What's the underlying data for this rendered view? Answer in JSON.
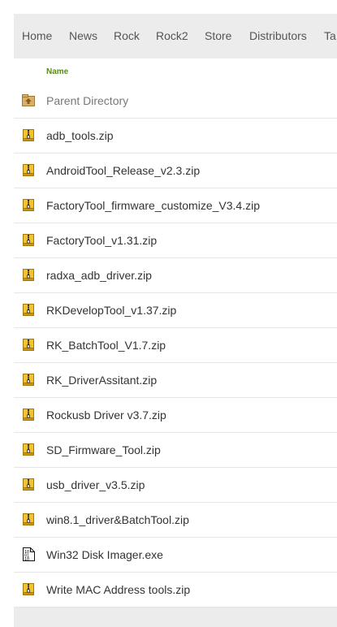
{
  "nav": {
    "items": [
      "Home",
      "News",
      "Rock",
      "Rock2",
      "Store",
      "Distributors",
      "Ta"
    ]
  },
  "table": {
    "header_name": "Name",
    "parent": {
      "label": "Parent Directory",
      "icon": "parent-folder-icon"
    },
    "files": [
      {
        "label": "adb_tools.zip",
        "icon": "zip-archive-icon"
      },
      {
        "label": "AndroidTool_Release_v2.3.zip",
        "icon": "zip-archive-icon"
      },
      {
        "label": "FactoryTool_firmware_customize_V3.4.zip",
        "icon": "zip-archive-icon"
      },
      {
        "label": "FactoryTool_v1.31.zip",
        "icon": "zip-archive-icon"
      },
      {
        "label": "radxa_adb_driver.zip",
        "icon": "zip-archive-icon"
      },
      {
        "label": "RKDevelopTool_v1.37.zip",
        "icon": "zip-archive-icon"
      },
      {
        "label": "RK_BatchTool_V1.7.zip",
        "icon": "zip-archive-icon"
      },
      {
        "label": "RK_DriverAssitant.zip",
        "icon": "zip-archive-icon"
      },
      {
        "label": "Rockusb Driver v3.7.zip",
        "icon": "zip-archive-icon"
      },
      {
        "label": "SD_Firmware_Tool.zip",
        "icon": "zip-archive-icon"
      },
      {
        "label": "usb_driver_v3.5.zip",
        "icon": "zip-archive-icon"
      },
      {
        "label": "win8.1_driver&BatchTool.zip",
        "icon": "zip-archive-icon"
      },
      {
        "label": "Win32 Disk Imager.exe",
        "icon": "binary-file-icon"
      },
      {
        "label": "Write MAC Address tools.zip",
        "icon": "zip-archive-icon"
      }
    ]
  }
}
